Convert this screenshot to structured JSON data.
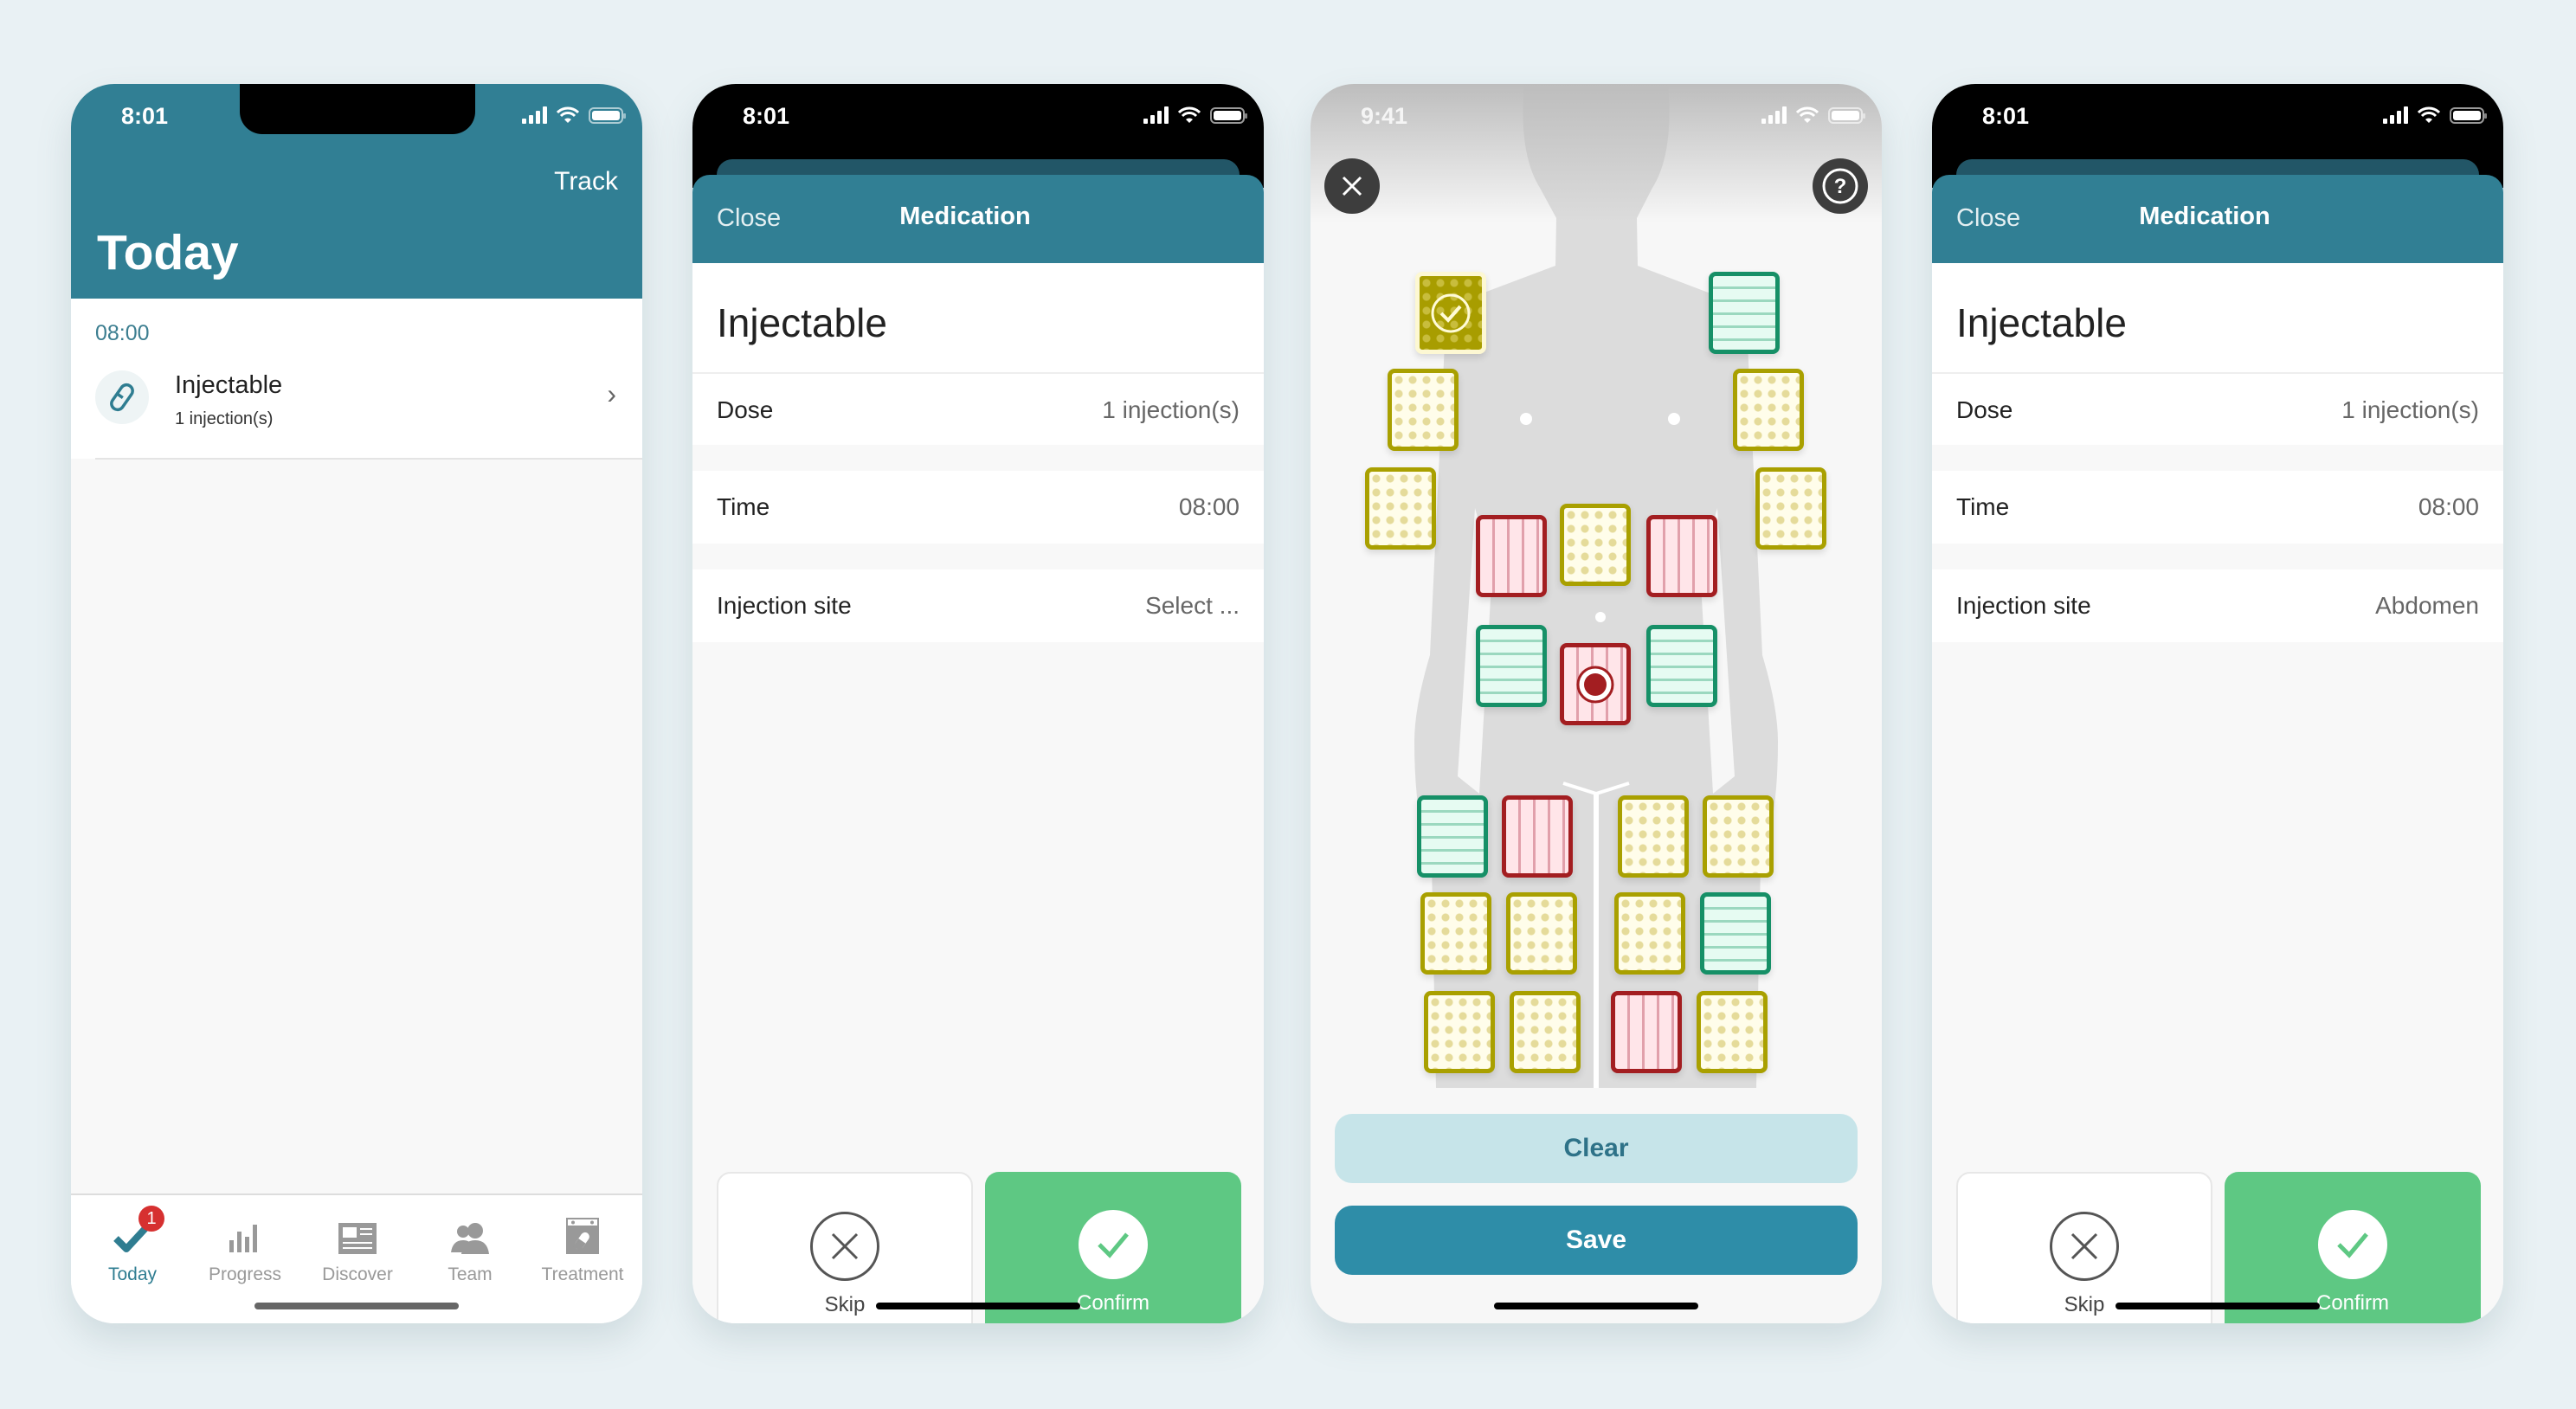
{
  "colors": {
    "brand_teal": "#317f94",
    "confirm_green": "#5ec883",
    "save_blue": "#2e8da8",
    "clear_light": "#c6e4e9",
    "badge_red": "#d63030",
    "site_available_yellow": "#a9a000",
    "site_recent_green": "#169067",
    "site_avoid_red": "#a31e21"
  },
  "screens": [
    {
      "id": "today",
      "status_bar": {
        "time": "8:01"
      },
      "header": {
        "action": "Track",
        "title": "Today"
      },
      "section_time": "08:00",
      "items": [
        {
          "icon": "pill-icon",
          "name": "Injectable",
          "dose": "1 injection(s)"
        }
      ],
      "tabbar": [
        {
          "label": "Today",
          "icon": "checkmark-icon",
          "active": true,
          "badge": "1"
        },
        {
          "label": "Progress",
          "icon": "bar-chart-icon",
          "active": false
        },
        {
          "label": "Discover",
          "icon": "newspaper-icon",
          "active": false
        },
        {
          "label": "Team",
          "icon": "people-icon",
          "active": false
        },
        {
          "label": "Treatment",
          "icon": "calendar-pill-icon",
          "active": false
        }
      ]
    },
    {
      "id": "medication-select",
      "status_bar": {
        "time": "8:01"
      },
      "header": {
        "close": "Close",
        "title": "Medication"
      },
      "med_name": "Injectable",
      "rows": [
        {
          "label": "Dose",
          "value": "1 injection(s)"
        },
        {
          "label": "Time",
          "value": "08:00"
        },
        {
          "label": "Injection site",
          "value": "Select ..."
        }
      ],
      "actions": {
        "skip": "Skip",
        "confirm": "Confirm"
      }
    },
    {
      "id": "injection-site-map",
      "status_bar": {
        "time": "9:41"
      },
      "buttons": {
        "clear": "Clear",
        "save": "Save"
      },
      "sites": [
        {
          "region": "left-upper-arm-1",
          "state": "selected"
        },
        {
          "region": "right-upper-arm-1",
          "state": "green"
        },
        {
          "region": "left-upper-arm-2",
          "state": "yellow"
        },
        {
          "region": "right-upper-arm-2",
          "state": "yellow"
        },
        {
          "region": "left-upper-arm-3",
          "state": "yellow"
        },
        {
          "region": "right-upper-arm-3",
          "state": "yellow"
        },
        {
          "region": "abdomen-upper-left",
          "state": "red"
        },
        {
          "region": "abdomen-upper-center",
          "state": "yellow"
        },
        {
          "region": "abdomen-upper-right",
          "state": "red"
        },
        {
          "region": "abdomen-lower-left",
          "state": "green"
        },
        {
          "region": "abdomen-navel",
          "state": "red",
          "marker": "target"
        },
        {
          "region": "abdomen-lower-right",
          "state": "green"
        },
        {
          "region": "left-thigh-outer-1",
          "state": "green"
        },
        {
          "region": "left-thigh-inner-1",
          "state": "red"
        },
        {
          "region": "right-thigh-inner-1",
          "state": "yellow"
        },
        {
          "region": "right-thigh-outer-1",
          "state": "yellow"
        },
        {
          "region": "left-thigh-outer-2",
          "state": "yellow"
        },
        {
          "region": "left-thigh-inner-2",
          "state": "yellow"
        },
        {
          "region": "right-thigh-inner-2",
          "state": "yellow"
        },
        {
          "region": "right-thigh-outer-2",
          "state": "green"
        },
        {
          "region": "left-thigh-outer-3",
          "state": "yellow"
        },
        {
          "region": "left-thigh-inner-3",
          "state": "yellow"
        },
        {
          "region": "right-thigh-inner-3",
          "state": "red"
        },
        {
          "region": "right-thigh-outer-3",
          "state": "yellow"
        }
      ]
    },
    {
      "id": "medication-selected",
      "status_bar": {
        "time": "8:01"
      },
      "header": {
        "close": "Close",
        "title": "Medication"
      },
      "med_name": "Injectable",
      "rows": [
        {
          "label": "Dose",
          "value": "1 injection(s)"
        },
        {
          "label": "Time",
          "value": "08:00"
        },
        {
          "label": "Injection site",
          "value": "Abdomen"
        }
      ],
      "actions": {
        "skip": "Skip",
        "confirm": "Confirm"
      }
    }
  ]
}
